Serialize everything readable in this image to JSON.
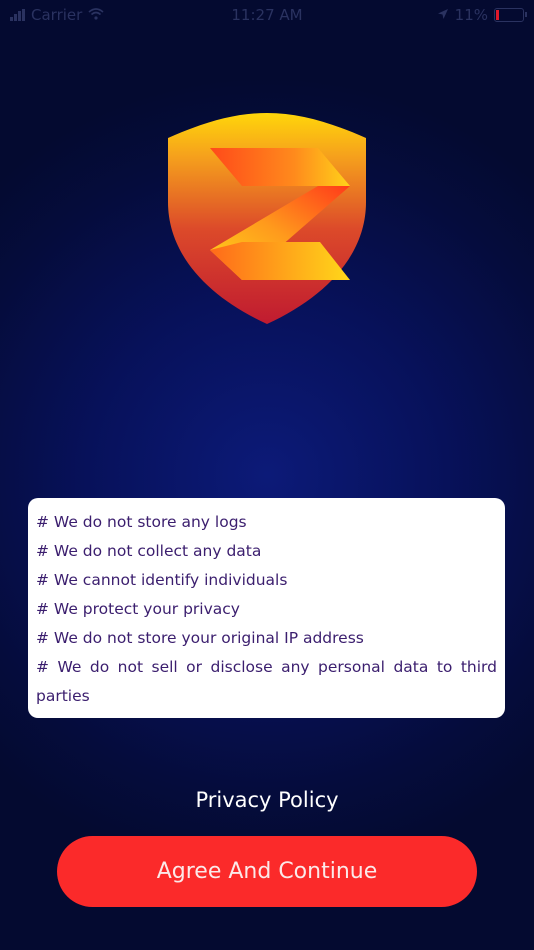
{
  "status_bar": {
    "carrier": "Carrier",
    "time": "11:27 AM",
    "battery_percent": "11%",
    "battery_level": 0.11
  },
  "features": [
    "# We do not store any logs",
    "# We do not collect any data",
    "# We cannot identify individuals",
    "# We protect your privacy",
    "# We do not store your original IP address",
    "# We do not sell or disclose any personal data to third parties"
  ],
  "privacy_link": "Privacy Policy",
  "agree_button": "Agree And Continue",
  "colors": {
    "background": "#07115a",
    "button": "#fb2a2a",
    "feature_text": "#3b1e6e",
    "shield_top": "#ffd60a",
    "shield_bottom": "#c61d2e"
  },
  "icons": {
    "logo": "z-shield-logo",
    "wifi": "wifi-icon",
    "location": "location-icon",
    "battery": "battery-icon"
  }
}
